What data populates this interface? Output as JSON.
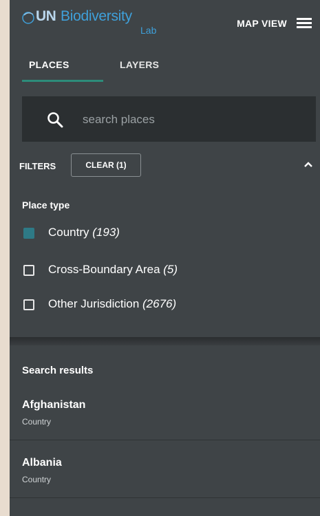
{
  "header": {
    "logo_un": "UN",
    "logo_biodiversity": "Biodiversity",
    "logo_lab": "Lab",
    "map_view_label": "MAP VIEW",
    "menu_icon": "hamburger-menu-icon"
  },
  "tabs": [
    {
      "label": "PLACES",
      "active": true
    },
    {
      "label": "LAYERS",
      "active": false
    }
  ],
  "search": {
    "placeholder": "search places",
    "value": "",
    "icon": "search-icon"
  },
  "filters": {
    "label": "FILTERS",
    "clear_label": "CLEAR (1)",
    "collapse_icon": "chevron-up-icon",
    "place_type_label": "Place type",
    "options": [
      {
        "label": "Country",
        "count": "(193)",
        "checked": true
      },
      {
        "label": "Cross-Boundary Area",
        "count": "(5)",
        "checked": false
      },
      {
        "label": "Other Jurisdiction",
        "count": "(2676)",
        "checked": false
      }
    ]
  },
  "results": {
    "title": "Search results",
    "items": [
      {
        "name": "Afghanistan",
        "type": "Country"
      },
      {
        "name": "Albania",
        "type": "Country"
      }
    ]
  },
  "colors": {
    "panel_bg": "#3f4447",
    "search_bg": "#2b2f31",
    "accent_teal": "#2d8c7a",
    "checkbox_checked": "#2e7a86",
    "logo_blue": "#3fa0da"
  }
}
